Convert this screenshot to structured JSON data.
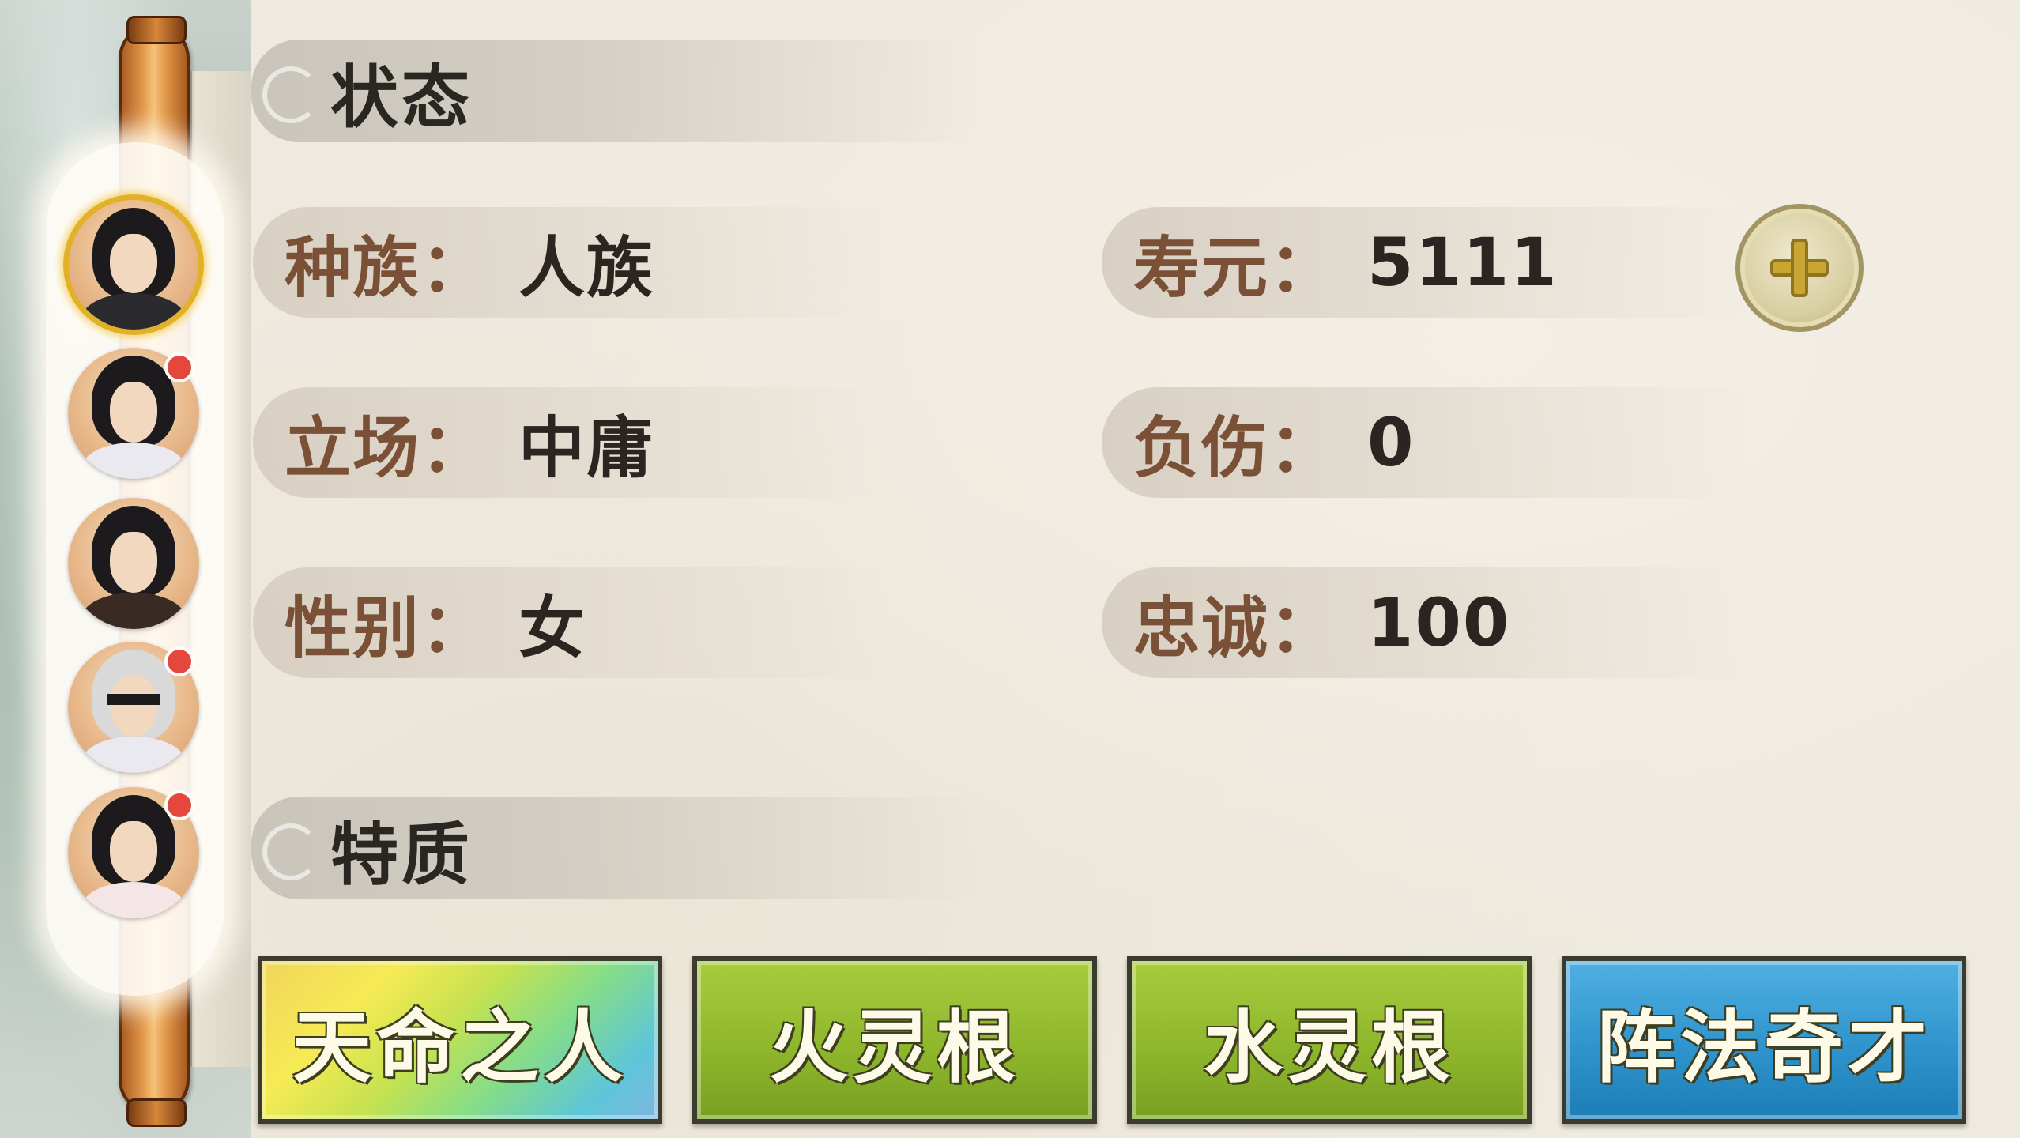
{
  "status_section": {
    "title": "状态"
  },
  "traits_section": {
    "title": "特质"
  },
  "stats_left": [
    {
      "label": "种族",
      "value": "人族"
    },
    {
      "label": "立场",
      "value": "中庸"
    },
    {
      "label": "性别",
      "value": "女"
    }
  ],
  "stats_right": [
    {
      "label": "寿元",
      "value": "5111"
    },
    {
      "label": "负伤",
      "value": "0"
    },
    {
      "label": "忠诚",
      "value": "100"
    }
  ],
  "colon": "：",
  "traits": [
    {
      "label": "天命之人",
      "style": "rainbow"
    },
    {
      "label": "火灵根",
      "style": "green"
    },
    {
      "label": "水灵根",
      "style": "green"
    },
    {
      "label": "阵法奇才",
      "style": "blue"
    }
  ],
  "characters": [
    {
      "icon": "character-portrait-icon",
      "selected": true,
      "notification": false
    },
    {
      "icon": "character-portrait-icon",
      "selected": false,
      "notification": true
    },
    {
      "icon": "character-portrait-icon",
      "selected": false,
      "notification": false
    },
    {
      "icon": "character-portrait-icon",
      "selected": false,
      "notification": true
    },
    {
      "icon": "character-portrait-icon",
      "selected": false,
      "notification": true
    }
  ],
  "add_lifespan_icon": "plus-circle-icon",
  "colors": {
    "label": "#7a5036",
    "value": "#2a2521",
    "trait_green": "#8fb72c",
    "trait_blue": "#2f94cd",
    "notification": "#e4483d",
    "selected_ring": "#e2b12a"
  }
}
